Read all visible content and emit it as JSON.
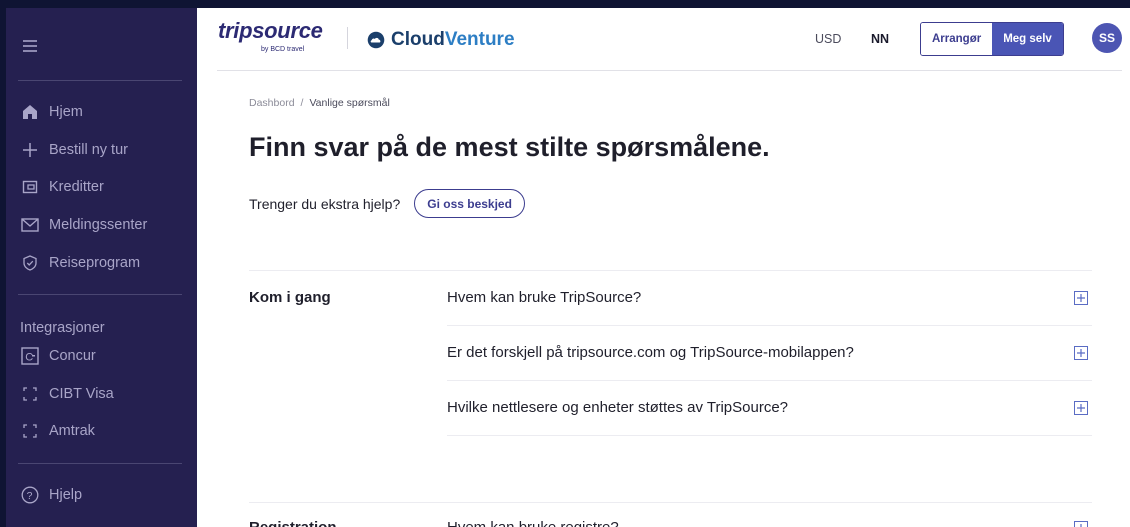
{
  "sidebar": {
    "items": [
      {
        "label": "Hjem",
        "icon": "home-icon"
      },
      {
        "label": "Bestill ny tur",
        "icon": "plus-icon"
      },
      {
        "label": "Kreditter",
        "icon": "wallet-icon"
      },
      {
        "label": "Meldingssenter",
        "icon": "mail-icon"
      },
      {
        "label": "Reiseprogram",
        "icon": "shield-check-icon"
      }
    ],
    "integrations_label": "Integrasjoner",
    "integrations": [
      {
        "label": "Concur",
        "icon": "concur-icon"
      },
      {
        "label": "CIBT Visa",
        "icon": "bracket-icon"
      },
      {
        "label": "Amtrak",
        "icon": "bracket-icon"
      }
    ],
    "help_label": "Hjelp"
  },
  "header": {
    "logo_trip": "tripsource",
    "logo_by": "by BCD travel",
    "logo_cloud": "Cloud",
    "logo_venture": "Venture",
    "currency": "USD",
    "language": "NN",
    "seg_arranger": "Arrangør",
    "seg_self": "Meg selv",
    "avatar_initials": "SS"
  },
  "breadcrumb": {
    "root": "Dashbord",
    "separator": "/",
    "current": "Vanlige spørsmål"
  },
  "page": {
    "title": "Finn svar på de mest stilte spørsmålene.",
    "help_text": "Trenger du ekstra hjelp?",
    "help_button": "Gi oss beskjed"
  },
  "faq": {
    "sections": [
      {
        "title": "Kom i gang",
        "questions": [
          "Hvem kan bruke TripSource?",
          "Er det forskjell på tripsource.com og TripSource-mobilappen?",
          "Hvilke nettlesere og enheter støttes av TripSource?"
        ]
      },
      {
        "title": "Registration",
        "questions": [
          "Hvem kan bruke registre?"
        ]
      }
    ]
  }
}
